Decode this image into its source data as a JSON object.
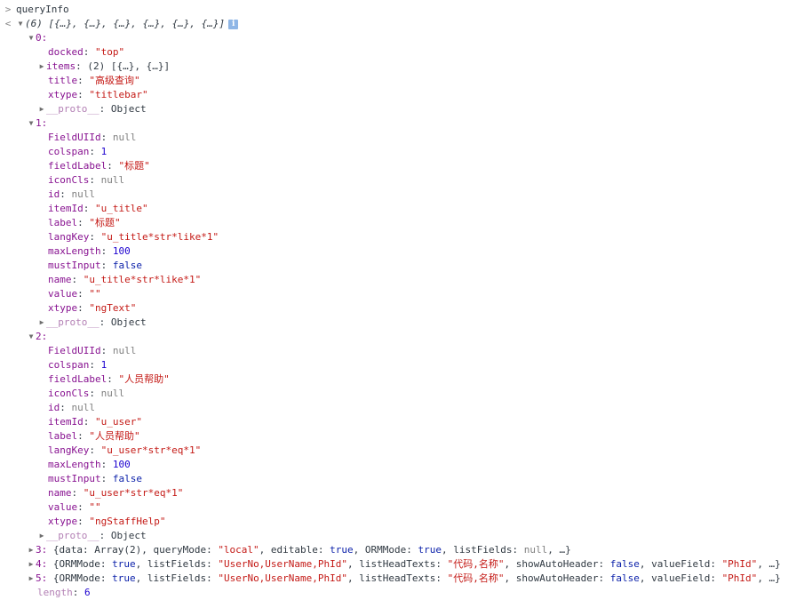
{
  "input_line": {
    "prompt": ">",
    "text": "queryInfo"
  },
  "result": {
    "prompt": "<",
    "summary": "(6) [{…}, {…}, {…}, {…}, {…}, {…}]",
    "info_badge": "i"
  },
  "items": [
    {
      "index": "0:",
      "props": [
        {
          "key": "docked",
          "value": "\"top\"",
          "type": "str"
        },
        {
          "key": "items",
          "value": "(2) [{…}, {…}]",
          "type": "punct",
          "collapsed": true
        },
        {
          "key": "title",
          "value": "\"高级查询\"",
          "type": "str"
        },
        {
          "key": "xtype",
          "value": "\"titlebar\"",
          "type": "str"
        },
        {
          "key": "__proto__",
          "value": "Object",
          "type": "punct",
          "collapsed": true,
          "proto": true
        }
      ]
    },
    {
      "index": "1:",
      "props": [
        {
          "key": "FieldUIId",
          "value": "null",
          "type": "nul"
        },
        {
          "key": "colspan",
          "value": "1",
          "type": "num"
        },
        {
          "key": "fieldLabel",
          "value": "\"标题\"",
          "type": "str"
        },
        {
          "key": "iconCls",
          "value": "null",
          "type": "nul"
        },
        {
          "key": "id",
          "value": "null",
          "type": "nul"
        },
        {
          "key": "itemId",
          "value": "\"u_title\"",
          "type": "str"
        },
        {
          "key": "label",
          "value": "\"标题\"",
          "type": "str"
        },
        {
          "key": "langKey",
          "value": "\"u_title*str*like*1\"",
          "type": "str"
        },
        {
          "key": "maxLength",
          "value": "100",
          "type": "num"
        },
        {
          "key": "mustInput",
          "value": "false",
          "type": "kw"
        },
        {
          "key": "name",
          "value": "\"u_title*str*like*1\"",
          "type": "str"
        },
        {
          "key": "value",
          "value": "\"\"",
          "type": "str"
        },
        {
          "key": "xtype",
          "value": "\"ngText\"",
          "type": "str"
        },
        {
          "key": "__proto__",
          "value": "Object",
          "type": "punct",
          "collapsed": true,
          "proto": true
        }
      ]
    },
    {
      "index": "2:",
      "props": [
        {
          "key": "FieldUIId",
          "value": "null",
          "type": "nul"
        },
        {
          "key": "colspan",
          "value": "1",
          "type": "num"
        },
        {
          "key": "fieldLabel",
          "value": "\"人员帮助\"",
          "type": "str"
        },
        {
          "key": "iconCls",
          "value": "null",
          "type": "nul"
        },
        {
          "key": "id",
          "value": "null",
          "type": "nul"
        },
        {
          "key": "itemId",
          "value": "\"u_user\"",
          "type": "str"
        },
        {
          "key": "label",
          "value": "\"人员帮助\"",
          "type": "str"
        },
        {
          "key": "langKey",
          "value": "\"u_user*str*eq*1\"",
          "type": "str"
        },
        {
          "key": "maxLength",
          "value": "100",
          "type": "num"
        },
        {
          "key": "mustInput",
          "value": "false",
          "type": "kw"
        },
        {
          "key": "name",
          "value": "\"u_user*str*eq*1\"",
          "type": "str"
        },
        {
          "key": "value",
          "value": "\"\"",
          "type": "str"
        },
        {
          "key": "xtype",
          "value": "\"ngStaffHelp\"",
          "type": "str"
        },
        {
          "key": "__proto__",
          "value": "Object",
          "type": "punct",
          "collapsed": true,
          "proto": true
        }
      ]
    }
  ],
  "collapsed_rows": [
    {
      "index": "3:",
      "segments": [
        {
          "t": "punct",
          "v": "{data: "
        },
        {
          "t": "punct",
          "v": "Array(2)"
        },
        {
          "t": "punct",
          "v": ", queryMode: "
        },
        {
          "t": "str",
          "v": "\"local\""
        },
        {
          "t": "punct",
          "v": ", editable: "
        },
        {
          "t": "kw",
          "v": "true"
        },
        {
          "t": "punct",
          "v": ", ORMMode: "
        },
        {
          "t": "kw",
          "v": "true"
        },
        {
          "t": "punct",
          "v": ", listFields: "
        },
        {
          "t": "nul",
          "v": "null"
        },
        {
          "t": "punct",
          "v": ", …}"
        }
      ]
    },
    {
      "index": "4:",
      "segments": [
        {
          "t": "punct",
          "v": "{ORMMode: "
        },
        {
          "t": "kw",
          "v": "true"
        },
        {
          "t": "punct",
          "v": ", listFields: "
        },
        {
          "t": "str",
          "v": "\"UserNo,UserName,PhId\""
        },
        {
          "t": "punct",
          "v": ", listHeadTexts: "
        },
        {
          "t": "str",
          "v": "\"代码,名称\""
        },
        {
          "t": "punct",
          "v": ", showAutoHeader: "
        },
        {
          "t": "kw",
          "v": "false"
        },
        {
          "t": "punct",
          "v": ", valueField: "
        },
        {
          "t": "str",
          "v": "\"PhId\""
        },
        {
          "t": "punct",
          "v": ", …}"
        }
      ]
    },
    {
      "index": "5:",
      "segments": [
        {
          "t": "punct",
          "v": "{ORMMode: "
        },
        {
          "t": "kw",
          "v": "true"
        },
        {
          "t": "punct",
          "v": ", listFields: "
        },
        {
          "t": "str",
          "v": "\"UserNo,UserName,PhId\""
        },
        {
          "t": "punct",
          "v": ", listHeadTexts: "
        },
        {
          "t": "str",
          "v": "\"代码,名称\""
        },
        {
          "t": "punct",
          "v": ", showAutoHeader: "
        },
        {
          "t": "kw",
          "v": "false"
        },
        {
          "t": "punct",
          "v": ", valueField: "
        },
        {
          "t": "str",
          "v": "\"PhId\""
        },
        {
          "t": "punct",
          "v": ", …}"
        }
      ]
    }
  ],
  "trailing": {
    "key": "length",
    "value": "6"
  },
  "colors": {
    "key": "#881391",
    "string": "#c41a16",
    "number": "#1c00cf",
    "keyword": "#0d22aa",
    "null": "#808080"
  }
}
